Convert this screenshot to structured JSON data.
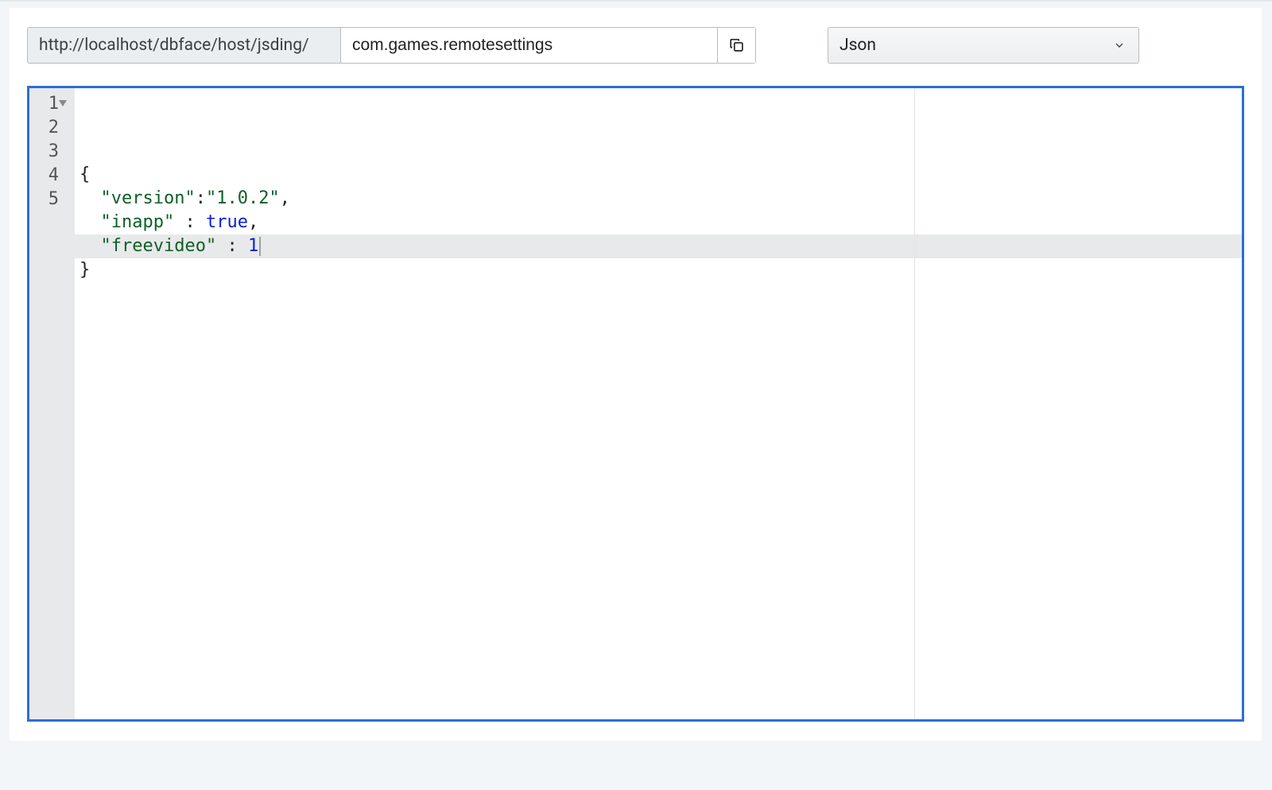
{
  "toolbar": {
    "url_prefix": "http://localhost/dbface/host/jsding/",
    "slug_value": "com.games.remotesettings",
    "copy_icon": "copy-icon",
    "format_selected": "Json"
  },
  "editor": {
    "active_line": 4,
    "ruler_col": 80,
    "lines": [
      {
        "n": 1,
        "foldable": true,
        "tokens": [
          {
            "t": "punct",
            "v": "{"
          }
        ]
      },
      {
        "n": 2,
        "foldable": false,
        "tokens": [
          {
            "t": "indent",
            "v": "  "
          },
          {
            "t": "key",
            "v": "\"version\""
          },
          {
            "t": "punct",
            "v": ":"
          },
          {
            "t": "str",
            "v": "\"1.0.2\""
          },
          {
            "t": "punct",
            "v": ","
          }
        ]
      },
      {
        "n": 3,
        "foldable": false,
        "tokens": [
          {
            "t": "indent",
            "v": "  "
          },
          {
            "t": "key",
            "v": "\"inapp\""
          },
          {
            "t": "punct",
            "v": " : "
          },
          {
            "t": "bool",
            "v": "true"
          },
          {
            "t": "punct",
            "v": ","
          }
        ]
      },
      {
        "n": 4,
        "foldable": false,
        "tokens": [
          {
            "t": "indent",
            "v": "  "
          },
          {
            "t": "key",
            "v": "\"freevideo\""
          },
          {
            "t": "punct",
            "v": " : "
          },
          {
            "t": "num",
            "v": "1"
          }
        ]
      },
      {
        "n": 5,
        "foldable": false,
        "tokens": [
          {
            "t": "punct",
            "v": "}"
          }
        ]
      }
    ]
  }
}
